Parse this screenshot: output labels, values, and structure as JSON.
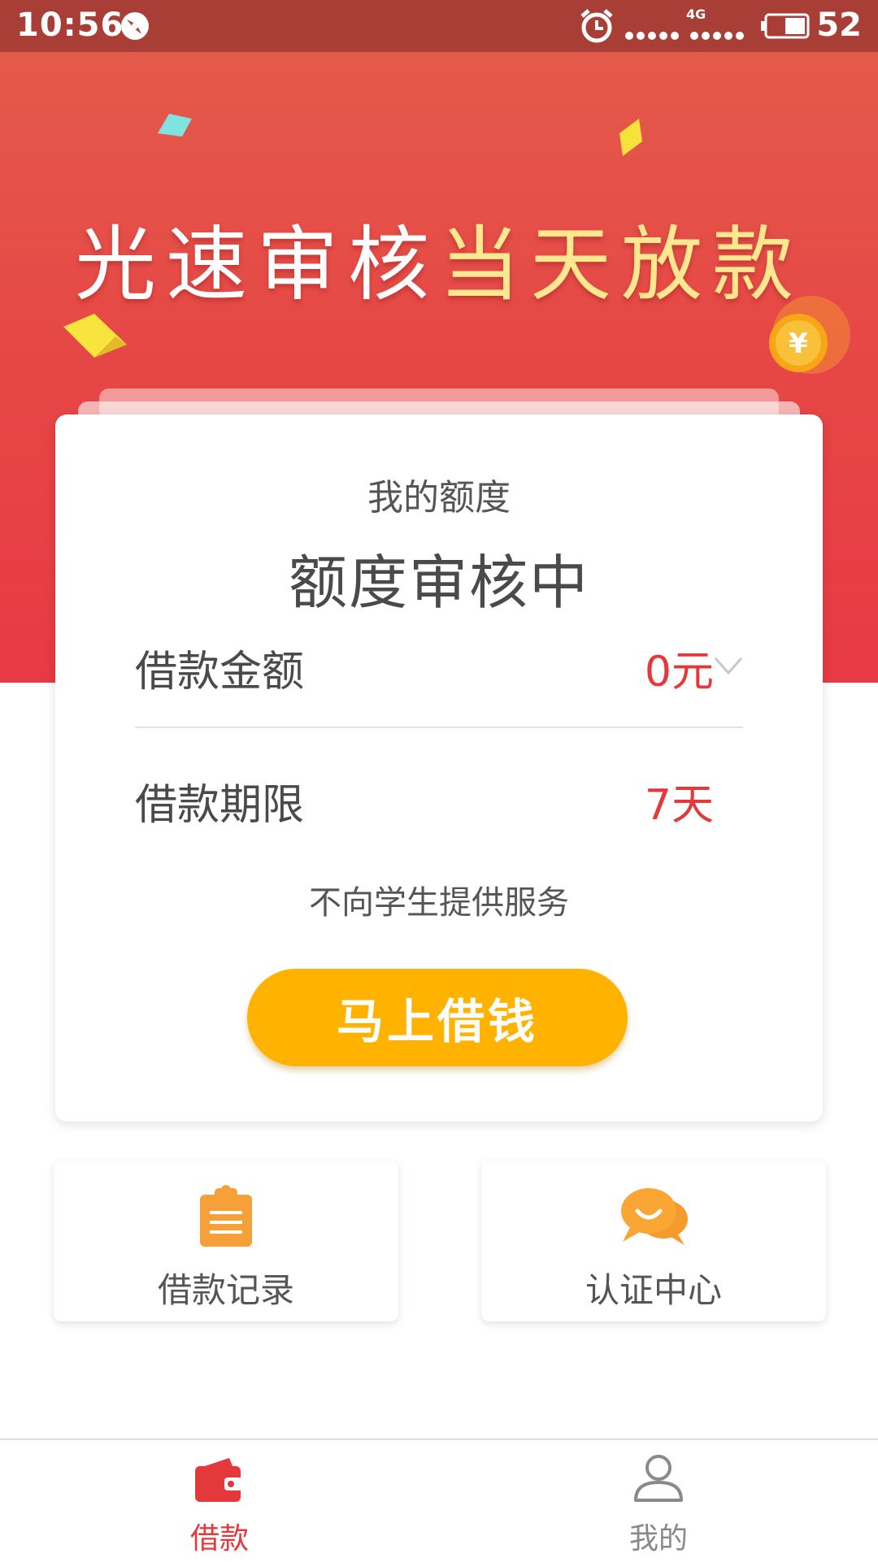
{
  "status_bar": {
    "time": "10:56",
    "battery_level": "52",
    "network_label": "4G",
    "icons": [
      "compass-icon",
      "alarm-icon",
      "signal-icon",
      "battery-icon"
    ]
  },
  "banner": {
    "title_part1": "光速审核",
    "title_part2": "当天放款",
    "colors": {
      "top": "#e45a4a",
      "bottom": "#e83a44",
      "highlight": "#fde78f"
    }
  },
  "credit_card": {
    "label": "我的额度",
    "status": "额度审核中",
    "amount_label": "借款金额",
    "amount_value": "0元",
    "term_label": "借款期限",
    "term_value": "7天",
    "notice": "不向学生提供服务",
    "button_label": "马上借钱",
    "button_color": "#ffb300",
    "value_color": "#e4393c"
  },
  "shortcuts": [
    {
      "label": "借款记录",
      "icon": "clipboard-icon"
    },
    {
      "label": "认证中心",
      "icon": "chat-bubbles-icon"
    }
  ],
  "tab_bar": {
    "tabs": [
      {
        "label": "借款",
        "icon": "wallet-icon",
        "active": true
      },
      {
        "label": "我的",
        "icon": "person-icon",
        "active": false
      }
    ],
    "active_color": "#e4393c",
    "inactive_color": "#888888"
  }
}
